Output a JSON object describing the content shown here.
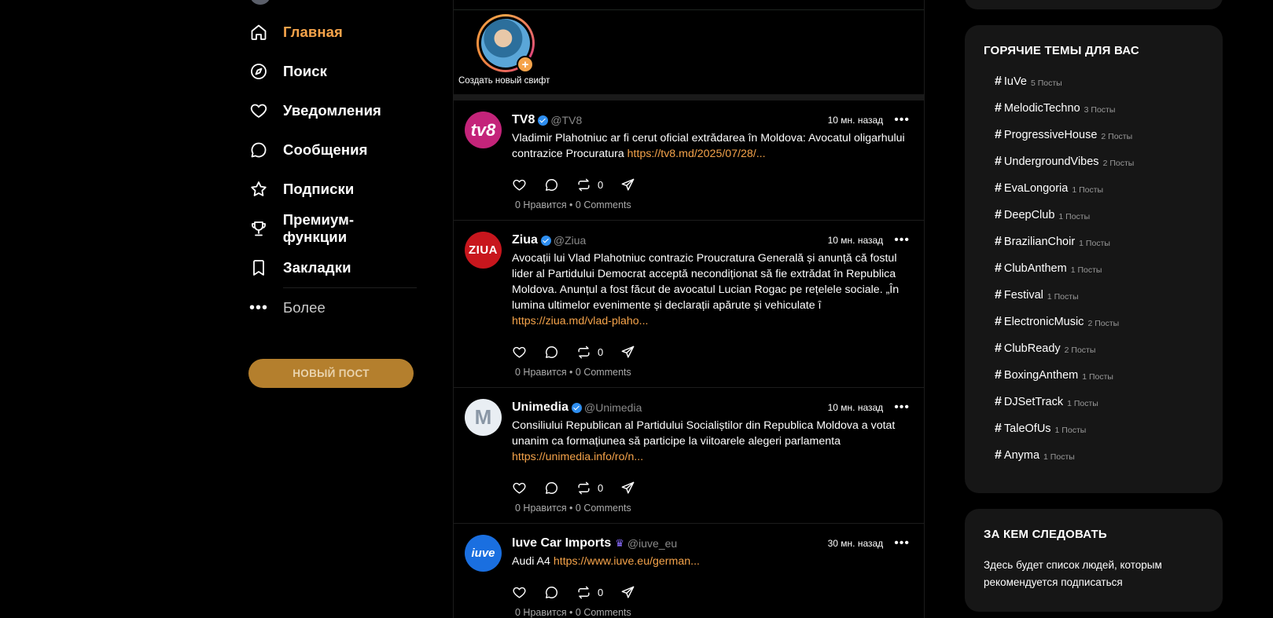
{
  "nav": {
    "items": [
      {
        "key": "home",
        "label": "Главная",
        "icon": "home-icon",
        "active": true
      },
      {
        "key": "search",
        "label": "Поиск",
        "icon": "compass-icon"
      },
      {
        "key": "notifications",
        "label": "Уведомления",
        "icon": "heart-icon"
      },
      {
        "key": "messages",
        "label": "Сообщения",
        "icon": "chat-bubble-icon"
      },
      {
        "key": "subscriptions",
        "label": "Подписки",
        "icon": "star-icon"
      },
      {
        "key": "premium",
        "label": "Премиум-функции",
        "icon": "trophy-icon"
      },
      {
        "key": "bookmarks",
        "label": "Закладки",
        "icon": "bookmark-icon"
      }
    ],
    "more_label": "Более",
    "new_post_label": "НОВЫЙ ПОСТ"
  },
  "stories": {
    "create_label": "Создать новый свифт",
    "plus": "+"
  },
  "posts": [
    {
      "name": "TV8",
      "handle": "@TV8",
      "badge": "verified",
      "time": "10 мн. назад",
      "text": "Vladimir Plahotniuc ar fi cerut oficial extrădarea în Moldova: Avocatul oligarhului contrazice Procuratura ",
      "link": "https://tv8.md/2025/07/28/...",
      "reposts": "0",
      "stats": "0 Нравится • 0 Comments",
      "avatar_text": "tv8",
      "avatar_color": "#c4247a"
    },
    {
      "name": "Ziua",
      "handle": "@Ziua",
      "badge": "verified",
      "time": "10 мн. назад",
      "text": "Avocații lui Vlad Plahotniuc contrazic Proucratura Generală și anunță că fostul lider al Partidului Democrat acceptă necondiționat să fie extrădat în Republica Moldova. Anunțul a fost făcut de avocatul Lucian Rogac pe rețelele sociale.    „În lumina ultimelor evenimente și declarații apărute și vehiculate î ",
      "link": "https://ziua.md/vlad-plaho...",
      "reposts": "0",
      "stats": "0 Нравится • 0 Comments",
      "avatar_text": "ZIUA",
      "avatar_color": "#c8161d"
    },
    {
      "name": "Unimedia",
      "handle": "@Unimedia",
      "badge": "verified",
      "time": "10 мн. назад",
      "text": "Consiliului Republican al Partidului Socialiștilor din Republica Moldova a votat unanim ca formațiunea să participe la viitoarele alegeri parlamenta ",
      "link": "https://unimedia.info/ro/n...",
      "reposts": "0",
      "stats": "0 Нравится • 0 Comments",
      "avatar_text": "M",
      "avatar_color": "#e9eef3"
    },
    {
      "name": "Iuve Car Imports",
      "handle": "@iuve_eu",
      "badge": "crown",
      "time": "30 мн. назад",
      "text": "Audi A4 ",
      "link": "https://www.iuve.eu/german...",
      "reposts": "0",
      "stats": "0 Нравится • 0 Comments",
      "avatar_text": "iuve",
      "avatar_color": "#1a6fe0"
    }
  ],
  "trends": {
    "title": "ГОРЯЧИЕ ТЕМЫ ДЛЯ ВАС",
    "items": [
      {
        "tag": "IuVe",
        "posts": "5 Посты"
      },
      {
        "tag": "MelodicTechno",
        "posts": "3 Посты"
      },
      {
        "tag": "ProgressiveHouse",
        "posts": "2 Посты"
      },
      {
        "tag": "UndergroundVibes",
        "posts": "2 Посты"
      },
      {
        "tag": "EvaLongoria",
        "posts": "1 Посты"
      },
      {
        "tag": "DeepClub",
        "posts": "1 Посты"
      },
      {
        "tag": "BrazilianChoir",
        "posts": "1 Посты"
      },
      {
        "tag": "ClubAnthem",
        "posts": "1 Посты"
      },
      {
        "tag": "Festival",
        "posts": "1 Посты"
      },
      {
        "tag": "ElectronicMusic",
        "posts": "2 Посты"
      },
      {
        "tag": "ClubReady",
        "posts": "2 Посты"
      },
      {
        "tag": "BoxingAnthem",
        "posts": "1 Посты"
      },
      {
        "tag": "DJSetTrack",
        "posts": "1 Посты"
      },
      {
        "tag": "TaleOfUs",
        "posts": "1 Посты"
      },
      {
        "tag": "Anyma",
        "posts": "1 Посты"
      }
    ]
  },
  "follow": {
    "title": "ЗА КЕМ СЛЕДОВАТЬ",
    "text": "Здесь будет список людей, которым рекомендуется подписаться"
  },
  "colors": {
    "accent": "#f5a34a",
    "button": "#b47f2d",
    "panel": "#161616",
    "verified": "#2e8ef0"
  }
}
